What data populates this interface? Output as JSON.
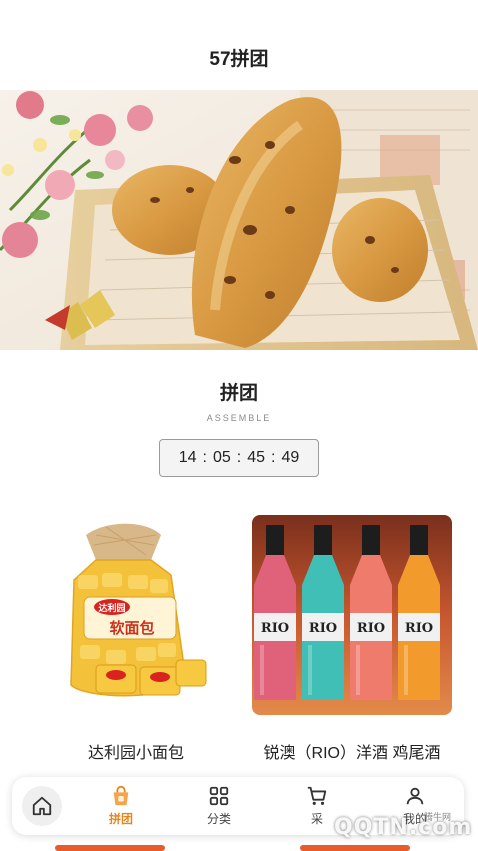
{
  "header": {
    "title": "57拼团"
  },
  "banner": {
    "icon": "bread-photo"
  },
  "section": {
    "title": "拼团",
    "subtitle": "ASSEMBLE"
  },
  "countdown": {
    "h": "14",
    "m": "05",
    "s": "45",
    "f": "49"
  },
  "products": [
    {
      "name": "达利园小面包",
      "pack_brand": "达利园",
      "pack_label": "软面包"
    },
    {
      "name": "锐澳（RIO）洋酒 鸡尾酒",
      "bottle_label": "RIO"
    }
  ],
  "tabbar": {
    "home_icon": "home-icon",
    "tabs": [
      {
        "label": "拼团",
        "icon": "shopping-bag-icon",
        "active": true
      },
      {
        "label": "分类",
        "icon": "grid-icon",
        "active": false
      },
      {
        "label": "采",
        "icon": "cart-icon",
        "active": false
      },
      {
        "label": "我的",
        "icon": "user-icon",
        "active": false
      }
    ]
  },
  "watermark": {
    "text": "QQTN.com",
    "small": "腾牛网"
  },
  "colors": {
    "accent": "#e6861f"
  }
}
